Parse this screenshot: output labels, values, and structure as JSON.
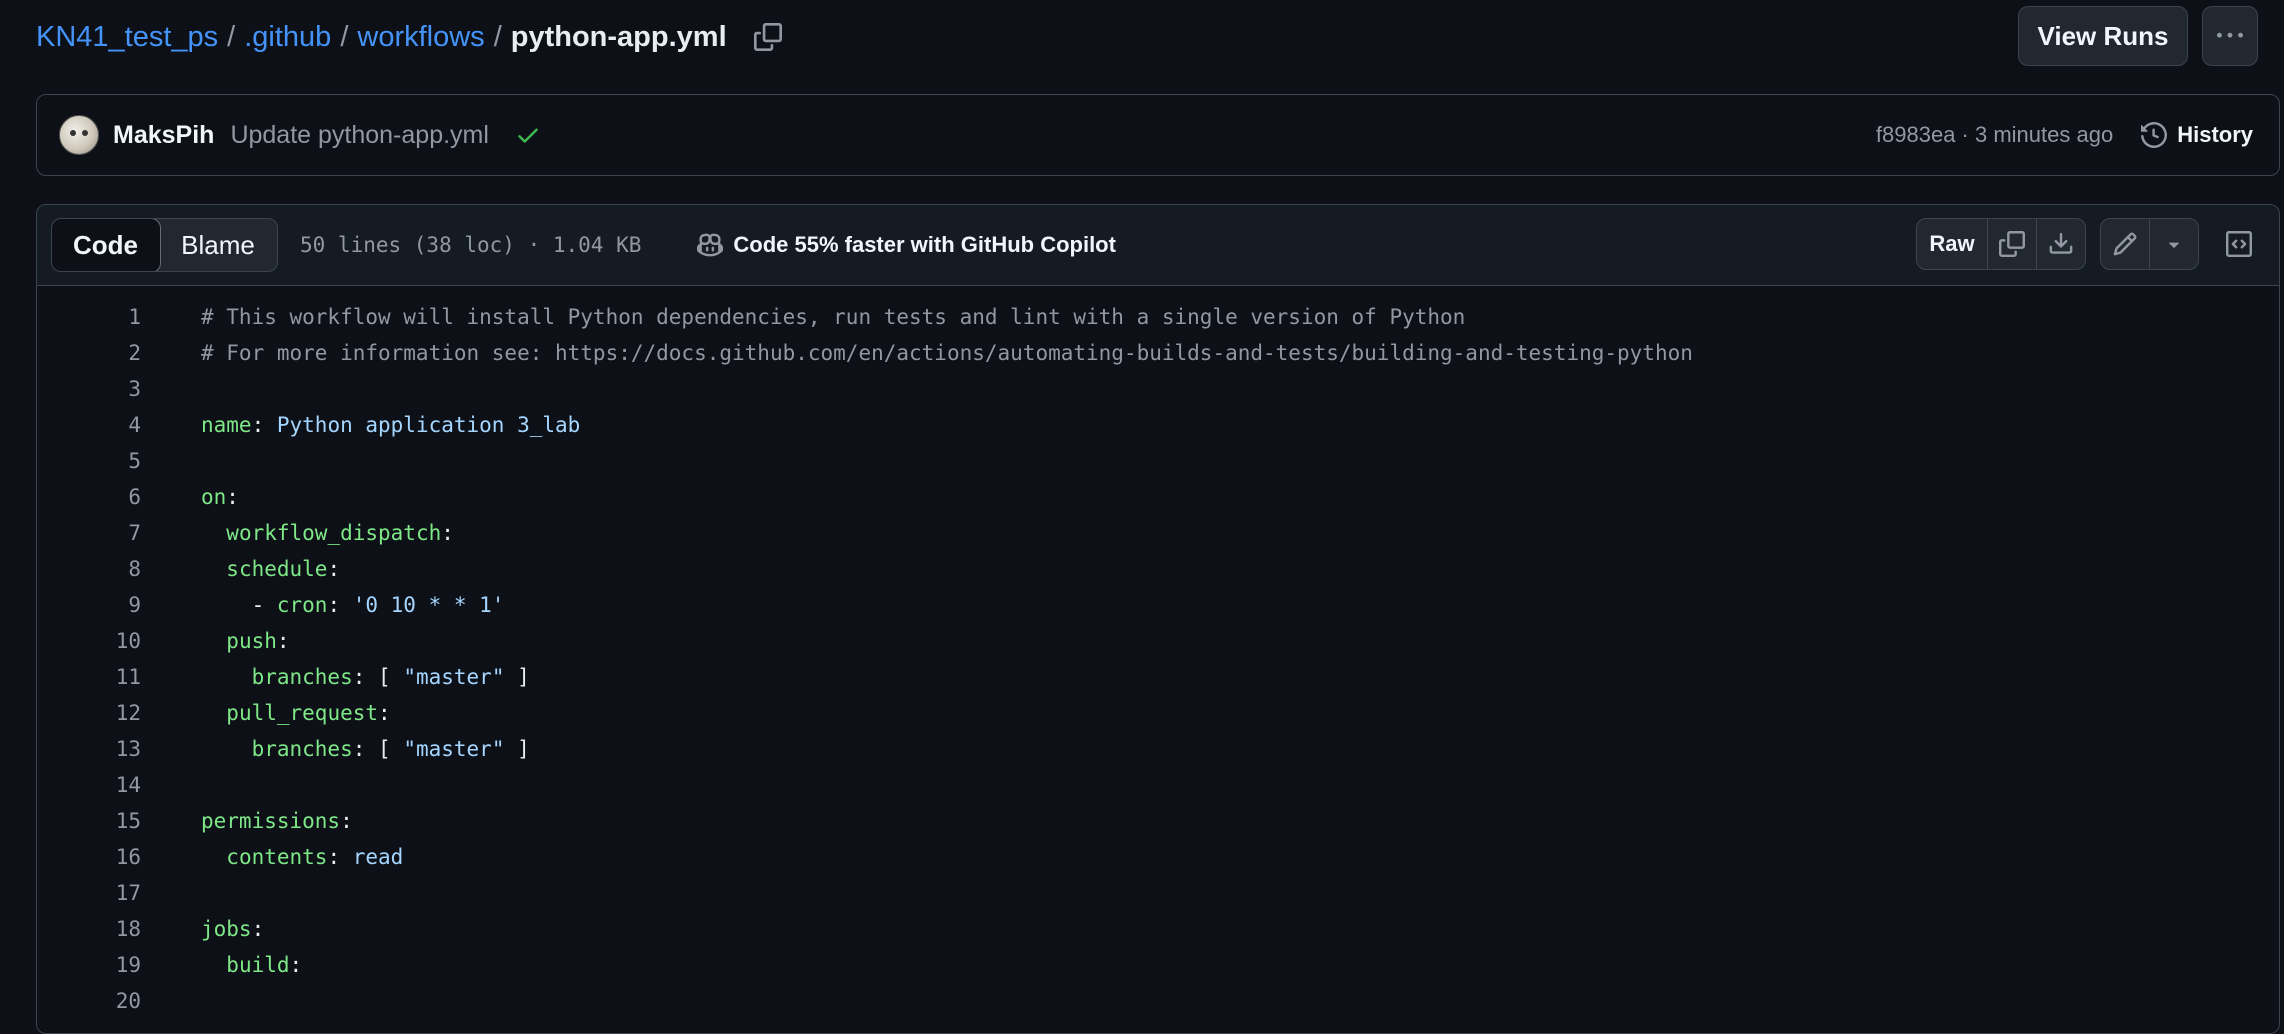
{
  "breadcrumb": {
    "repo": "KN41_test_ps",
    "sep": "/",
    "dir1": ".github",
    "dir2": "workflows",
    "file": "python-app.yml"
  },
  "actions": {
    "view_runs": "View Runs"
  },
  "commit": {
    "author": "MaksPih",
    "message": "Update python-app.yml",
    "meta": "f8983ea · 3 minutes ago",
    "history_label": "History"
  },
  "file_header": {
    "code_tab": "Code",
    "blame_tab": "Blame",
    "info": "50 lines (38 loc) · 1.04 KB",
    "copilot": "Code 55% faster with GitHub Copilot",
    "raw": "Raw"
  },
  "code_lines": [
    {
      "n": "1",
      "parts": [
        [
          "comment",
          "# This workflow will install Python dependencies, run tests and lint with a single version of Python"
        ]
      ]
    },
    {
      "n": "2",
      "parts": [
        [
          "comment",
          "# For more information see: https://docs.github.com/en/actions/automating-builds-and-tests/building-and-testing-python"
        ]
      ]
    },
    {
      "n": "3",
      "parts": []
    },
    {
      "n": "4",
      "parts": [
        [
          "key",
          "name"
        ],
        [
          "punc",
          ": "
        ],
        [
          "str",
          "Python application 3_lab"
        ]
      ]
    },
    {
      "n": "5",
      "parts": []
    },
    {
      "n": "6",
      "parts": [
        [
          "key",
          "on"
        ],
        [
          "punc",
          ":"
        ]
      ]
    },
    {
      "n": "7",
      "parts": [
        [
          "punc",
          "  "
        ],
        [
          "key",
          "workflow_dispatch"
        ],
        [
          "punc",
          ":"
        ]
      ]
    },
    {
      "n": "8",
      "parts": [
        [
          "punc",
          "  "
        ],
        [
          "key",
          "schedule"
        ],
        [
          "punc",
          ":"
        ]
      ]
    },
    {
      "n": "9",
      "parts": [
        [
          "punc",
          "    - "
        ],
        [
          "key",
          "cron"
        ],
        [
          "punc",
          ": "
        ],
        [
          "str",
          "'0 10 * * 1'"
        ]
      ]
    },
    {
      "n": "10",
      "parts": [
        [
          "punc",
          "  "
        ],
        [
          "key",
          "push"
        ],
        [
          "punc",
          ":"
        ]
      ]
    },
    {
      "n": "11",
      "parts": [
        [
          "punc",
          "    "
        ],
        [
          "key",
          "branches"
        ],
        [
          "punc",
          ": [ "
        ],
        [
          "str",
          "\"master\""
        ],
        [
          "punc",
          " ]"
        ]
      ]
    },
    {
      "n": "12",
      "parts": [
        [
          "punc",
          "  "
        ],
        [
          "key",
          "pull_request"
        ],
        [
          "punc",
          ":"
        ]
      ]
    },
    {
      "n": "13",
      "parts": [
        [
          "punc",
          "    "
        ],
        [
          "key",
          "branches"
        ],
        [
          "punc",
          ": [ "
        ],
        [
          "str",
          "\"master\""
        ],
        [
          "punc",
          " ]"
        ]
      ]
    },
    {
      "n": "14",
      "parts": []
    },
    {
      "n": "15",
      "parts": [
        [
          "key",
          "permissions"
        ],
        [
          "punc",
          ":"
        ]
      ]
    },
    {
      "n": "16",
      "parts": [
        [
          "punc",
          "  "
        ],
        [
          "key",
          "contents"
        ],
        [
          "punc",
          ": "
        ],
        [
          "str",
          "read"
        ]
      ]
    },
    {
      "n": "17",
      "parts": []
    },
    {
      "n": "18",
      "parts": [
        [
          "key",
          "jobs"
        ],
        [
          "punc",
          ":"
        ]
      ]
    },
    {
      "n": "19",
      "parts": [
        [
          "punc",
          "  "
        ],
        [
          "key",
          "build"
        ],
        [
          "punc",
          ":"
        ]
      ]
    },
    {
      "n": "20",
      "parts": []
    }
  ]
}
